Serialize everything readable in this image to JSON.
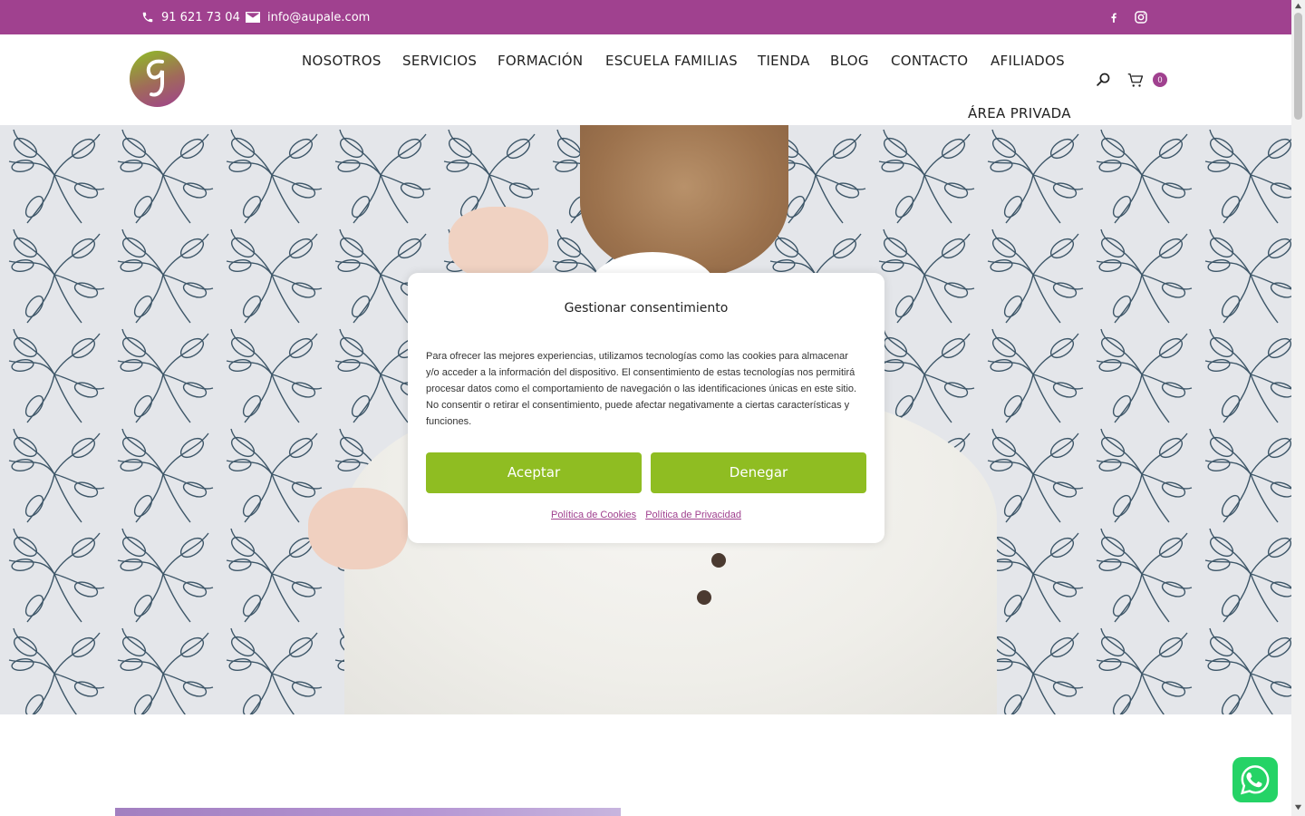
{
  "topbar": {
    "phone": "91 621 73 04",
    "email": "info@aupale.com",
    "icons": [
      "phone-icon",
      "mail-icon",
      "facebook-icon",
      "instagram-icon"
    ],
    "color": "#a0418f"
  },
  "nav": {
    "items": [
      "NOSOTROS",
      "SERVICIOS",
      "FORMACIÓN",
      "ESCUELA FAMILIAS",
      "TIENDA",
      "BLOG",
      "CONTACTO",
      "AFILIADOS",
      "ÁREA PRIVADA"
    ],
    "cart_count": "0",
    "icons": [
      "search-icon",
      "cart-icon"
    ]
  },
  "modal": {
    "title": "Gestionar consentimiento",
    "text": "Para ofrecer las mejores experiencias, utilizamos tecnologías como las cookies para almacenar y/o acceder a la información del dispositivo. El consentimiento de estas tecnologías nos permitirá procesar datos como el comportamiento de navegación o las identificaciones únicas en este sitio. No consentir o retirar el consentimiento, puede afectar negativamente a ciertas características y funciones.",
    "accept_label": "Aceptar",
    "deny_label": "Denegar",
    "cookies_link": "Política de Cookies",
    "privacy_link": "Política de Privacidad",
    "button_color": "#8fbd22"
  },
  "whatsapp": {
    "icon": "whatsapp-icon",
    "color": "#25d366"
  }
}
